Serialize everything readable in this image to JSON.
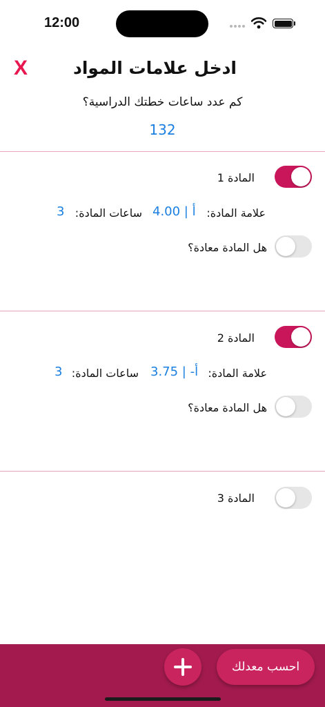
{
  "status_bar": {
    "time": "12:00"
  },
  "header": {
    "close_label": "X",
    "title": "ادخل علامات المواد"
  },
  "plan": {
    "question": "كم عدد ساعات خطتك الدراسية؟",
    "hours": "132"
  },
  "subjects": [
    {
      "name": "المادة 1",
      "enabled": true,
      "grade_label": "علامة المادة:",
      "grade_value": "أ | 4.00",
      "hours_label": "ساعات المادة:",
      "hours_value": "3",
      "repeated_label": "هل المادة معادة؟",
      "repeated": false
    },
    {
      "name": "المادة 2",
      "enabled": true,
      "grade_label": "علامة المادة:",
      "grade_value": "أ- | 3.75",
      "hours_label": "ساعات المادة:",
      "hours_value": "3",
      "repeated_label": "هل المادة معادة؟",
      "repeated": false
    },
    {
      "name": "المادة 3",
      "enabled": false
    }
  ],
  "footer": {
    "calculate_label": "احسب معدلك",
    "add_icon": "plus-icon"
  },
  "colors": {
    "accent": "#c9165a",
    "bottom_bar": "#a31b4e",
    "link": "#1a7fe0",
    "close": "#e8174f",
    "divider": "#e9a5b7"
  }
}
